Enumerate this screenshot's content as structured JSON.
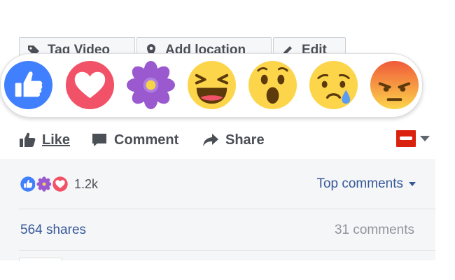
{
  "toolbar": {
    "tag_video": "Tag Video",
    "add_location": "Add location",
    "edit": "Edit"
  },
  "reactions": [
    {
      "name": "like",
      "color": "#4080ff"
    },
    {
      "name": "love",
      "color": "#f25268"
    },
    {
      "name": "thankful",
      "color": "#9b59d0"
    },
    {
      "name": "haha",
      "color": "#fcd54b"
    },
    {
      "name": "wow",
      "color": "#fcd54b"
    },
    {
      "name": "sad",
      "color": "#fcd54b"
    },
    {
      "name": "angry",
      "color": "#f05a3a"
    }
  ],
  "actions": {
    "like": "Like",
    "comment": "Comment",
    "share": "Share"
  },
  "summary": {
    "reaction_count": "1.2k",
    "top_comments": "Top comments"
  },
  "footer": {
    "shares": "564 shares",
    "comments": "31 comments"
  },
  "colors": {
    "link": "#365899",
    "text": "#4b4f56",
    "muted": "#90949c"
  }
}
